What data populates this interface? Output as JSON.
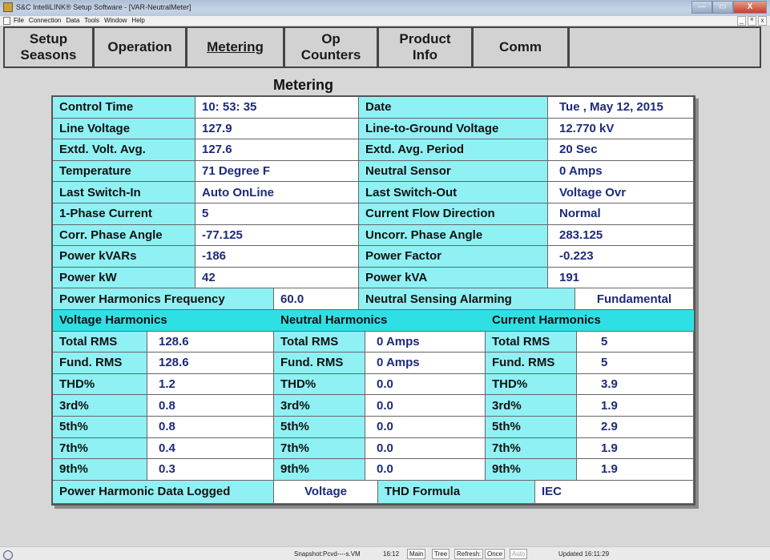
{
  "window": {
    "title": "S&C IntelliLINK® Setup Software - [VAR-NeutralMeter]",
    "minimize": "—",
    "maximize": "▭",
    "close": "X"
  },
  "menu": {
    "items": [
      "File",
      "Connection",
      "Data",
      "Tools",
      "Window",
      "Help"
    ],
    "mdi": [
      "_",
      "ᴿ",
      "x"
    ]
  },
  "tabs": [
    {
      "line1": "Setup",
      "line2": "Seasons"
    },
    {
      "line1": "Operation",
      "line2": ""
    },
    {
      "line1": "Metering",
      "line2": ""
    },
    {
      "line1": "Op",
      "line2": "Counters"
    },
    {
      "line1": "Product",
      "line2": "Info"
    },
    {
      "line1": "Comm",
      "line2": ""
    },
    {
      "line1": "",
      "line2": ""
    }
  ],
  "page_title": "Metering",
  "metering": {
    "rows": [
      {
        "l1": "Control Time",
        "v1": "10: 53: 35",
        "l2": "Date",
        "v2": "Tue  , May 12, 2015"
      },
      {
        "l1": "Line Voltage",
        "v1": "127.9",
        "l2": "Line-to-Ground Voltage",
        "v2": "12.770 kV"
      },
      {
        "l1": "Extd. Volt. Avg.",
        "v1": "127.6",
        "l2": "Extd. Avg. Period",
        "v2": "20 Sec"
      },
      {
        "l1": "Temperature",
        "v1": "71   Degree F",
        "l2": "Neutral Sensor",
        "v2": "0  Amps"
      },
      {
        "l1": "Last Switch-In",
        "v1": "Auto OnLine",
        "l2": "Last Switch-Out",
        "v2": "Voltage Ovr"
      },
      {
        "l1": "1-Phase Current",
        "v1": "5",
        "l2": "Current Flow Direction",
        "v2": "Normal"
      },
      {
        "l1": "Corr. Phase Angle",
        "v1": "-77.125",
        "l2": "Uncorr. Phase Angle",
        "v2": "283.125"
      },
      {
        "l1": "Power kVARs",
        "v1": "-186",
        "l2": "Power Factor",
        "v2": "-0.223"
      },
      {
        "l1": "Power kW",
        "v1": "42",
        "l2": "Power kVA",
        "v2": "191"
      }
    ],
    "harm_freq_label": "Power Harmonics Frequency",
    "harm_freq_value": "60.0",
    "neutral_alarm_label": "Neutral Sensing Alarming",
    "neutral_alarm_value": "Fundamental"
  },
  "harmonics": {
    "headers": [
      "Voltage Harmonics",
      "Neutral Harmonics",
      "Current Harmonics"
    ],
    "rows": [
      {
        "label": "Total RMS",
        "voltage": "128.6",
        "neutral": "0  Amps",
        "current": "5"
      },
      {
        "label": "Fund. RMS",
        "voltage": "128.6",
        "neutral": "0  Amps",
        "current": "5"
      },
      {
        "label": "THD%",
        "voltage": "1.2",
        "neutral": "0.0",
        "current": "3.9"
      },
      {
        "label": "3rd%",
        "voltage": "0.8",
        "neutral": "0.0",
        "current": "1.9"
      },
      {
        "label": "5th%",
        "voltage": "0.8",
        "neutral": "0.0",
        "current": "2.9"
      },
      {
        "label": "7th%",
        "voltage": "0.4",
        "neutral": "0.0",
        "current": "1.9"
      },
      {
        "label": "9th%",
        "voltage": "0.3",
        "neutral": "0.0",
        "current": "1.9"
      }
    ],
    "logged_label": "Power Harmonic Data Logged",
    "logged_value": "Voltage",
    "formula_label": "THD Formula",
    "formula_value": "IEC"
  },
  "status": {
    "snapshot": "Snapshot:Pcvd----s.VM",
    "time": "16:12",
    "buttons": [
      "Main",
      "Tree",
      "Refresh:",
      "Once",
      "Auto"
    ],
    "updated": "Updated 16:11:29"
  },
  "colors": {
    "label_bg": "#8ff1f4",
    "header_bg": "#2ee0e4",
    "value_text": "#1c2a7a"
  }
}
